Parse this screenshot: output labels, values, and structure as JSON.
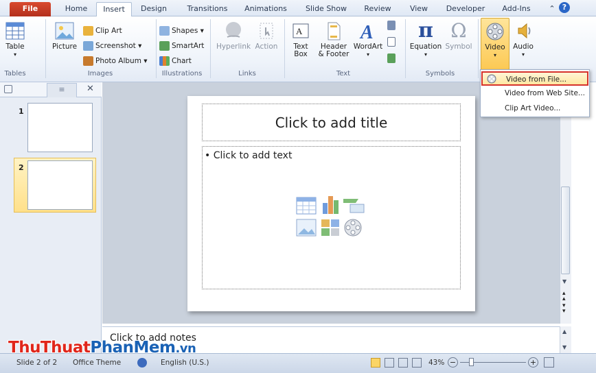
{
  "tabs": [
    "File",
    "Home",
    "Insert",
    "Design",
    "Transitions",
    "Animations",
    "Slide Show",
    "Review",
    "View",
    "Developer",
    "Add-Ins"
  ],
  "ribbon": {
    "groups": {
      "tables": "Tables",
      "images": "Images",
      "illustrations": "Illustrations",
      "links": "Links",
      "text": "Text",
      "symbols": "Symbols"
    },
    "table": "Table",
    "picture": "Picture",
    "clip_art": "Clip Art",
    "screenshot": "Screenshot ▾",
    "photo_album": "Photo Album ▾",
    "shapes": "Shapes ▾",
    "smartart": "SmartArt",
    "chart": "Chart",
    "hyperlink": "Hyperlink",
    "action": "Action",
    "textbox_1": "Text",
    "textbox_2": "Box",
    "header_1": "Header",
    "header_2": "& Footer",
    "wordart": "WordArt",
    "equation": "Equation",
    "symbol": "Symbol",
    "video": "Video",
    "audio": "Audio"
  },
  "dropdown": {
    "items": [
      {
        "label": "Video from File..."
      },
      {
        "label": "Video from Web Site..."
      },
      {
        "label": "Clip Art Video..."
      }
    ]
  },
  "slides": {
    "numbers": [
      "1",
      "2"
    ]
  },
  "slide": {
    "title": "Click to add title",
    "content": "• Click to add text"
  },
  "notes": "Click to add notes",
  "status": {
    "slide": "Slide 2 of 2",
    "theme": "Office Theme",
    "language": "English (U.S.)",
    "zoom": "43%"
  },
  "watermark": {
    "part1": "ThuThuat",
    "part2": "PhanMem",
    "part3": ".vn"
  },
  "colors": {
    "file_tab": "#c73b24",
    "highlight_border": "#d6312b",
    "watermark_red": "#e0261b",
    "watermark_blue": "#1a62b5"
  }
}
